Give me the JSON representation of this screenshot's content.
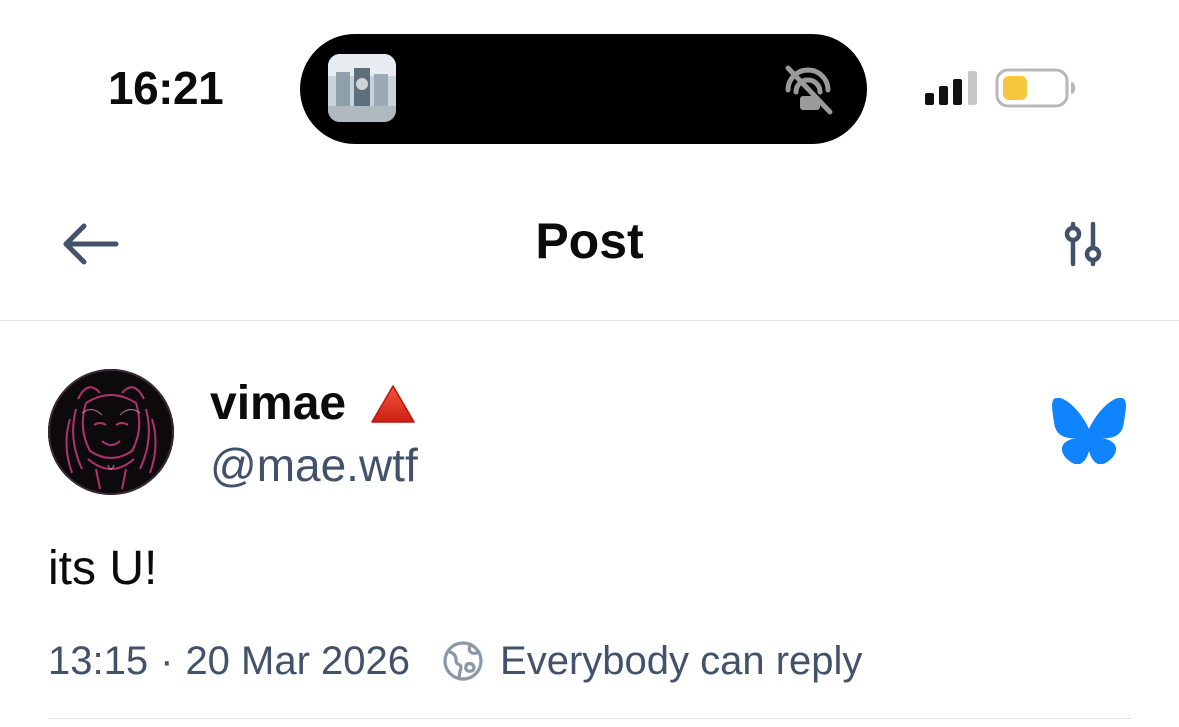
{
  "status_bar": {
    "time": "16:21",
    "signal_icon": "cellular-signal-icon",
    "battery_icon": "battery-low-power-icon",
    "battery_color": "#f5c83b",
    "island_icon": "muted-cast-icon"
  },
  "header": {
    "title": "Post",
    "back_icon": "arrow-left-icon",
    "settings_icon": "sliders-icon",
    "icon_color": "#42526b"
  },
  "post": {
    "author": {
      "display_name": "vimae",
      "name_emoji": "🔺",
      "handle": "@mae.wtf"
    },
    "brand_icon": "bluesky-butterfly-icon",
    "brand_color": "#1083fe",
    "text": "its U!",
    "timestamp": "13:15",
    "separator": "·",
    "date": "20 Mar 2026",
    "reply_setting": "Everybody can reply",
    "reply_icon": "globe-icon",
    "muted_text_color": "#42526b"
  }
}
